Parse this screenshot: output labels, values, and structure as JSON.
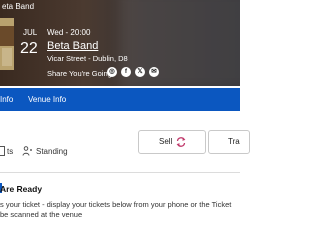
{
  "header": {
    "breadcrumb": "eta Band",
    "month": "JUL",
    "day": "22",
    "datetime": "Wed - 20:00",
    "event_title": "Beta Band",
    "venue": "Vicar Street - Dublin, D8",
    "share_label": "Share You're Going",
    "share_icons": [
      {
        "name": "social-icon-1",
        "glyph": "◎"
      },
      {
        "name": "facebook-icon",
        "glyph": "f"
      },
      {
        "name": "x-twitter-icon",
        "glyph": "𝕏"
      },
      {
        "name": "email-icon",
        "glyph": "✉"
      }
    ]
  },
  "nav": {
    "tab1": "Info",
    "tab2": "Venue Info"
  },
  "ticket": {
    "seat_type": "ts",
    "standing": "Standing",
    "sell_label": "Sell",
    "transfer_label": "Tra"
  },
  "notice": {
    "title": "Are Ready",
    "line1": "s your ticket - display your tickets below from your phone or the Ticket",
    "line2": "be scanned at the venue"
  },
  "colors": {
    "accent": "#0b57c0",
    "sell_icon": "#c0396b"
  }
}
